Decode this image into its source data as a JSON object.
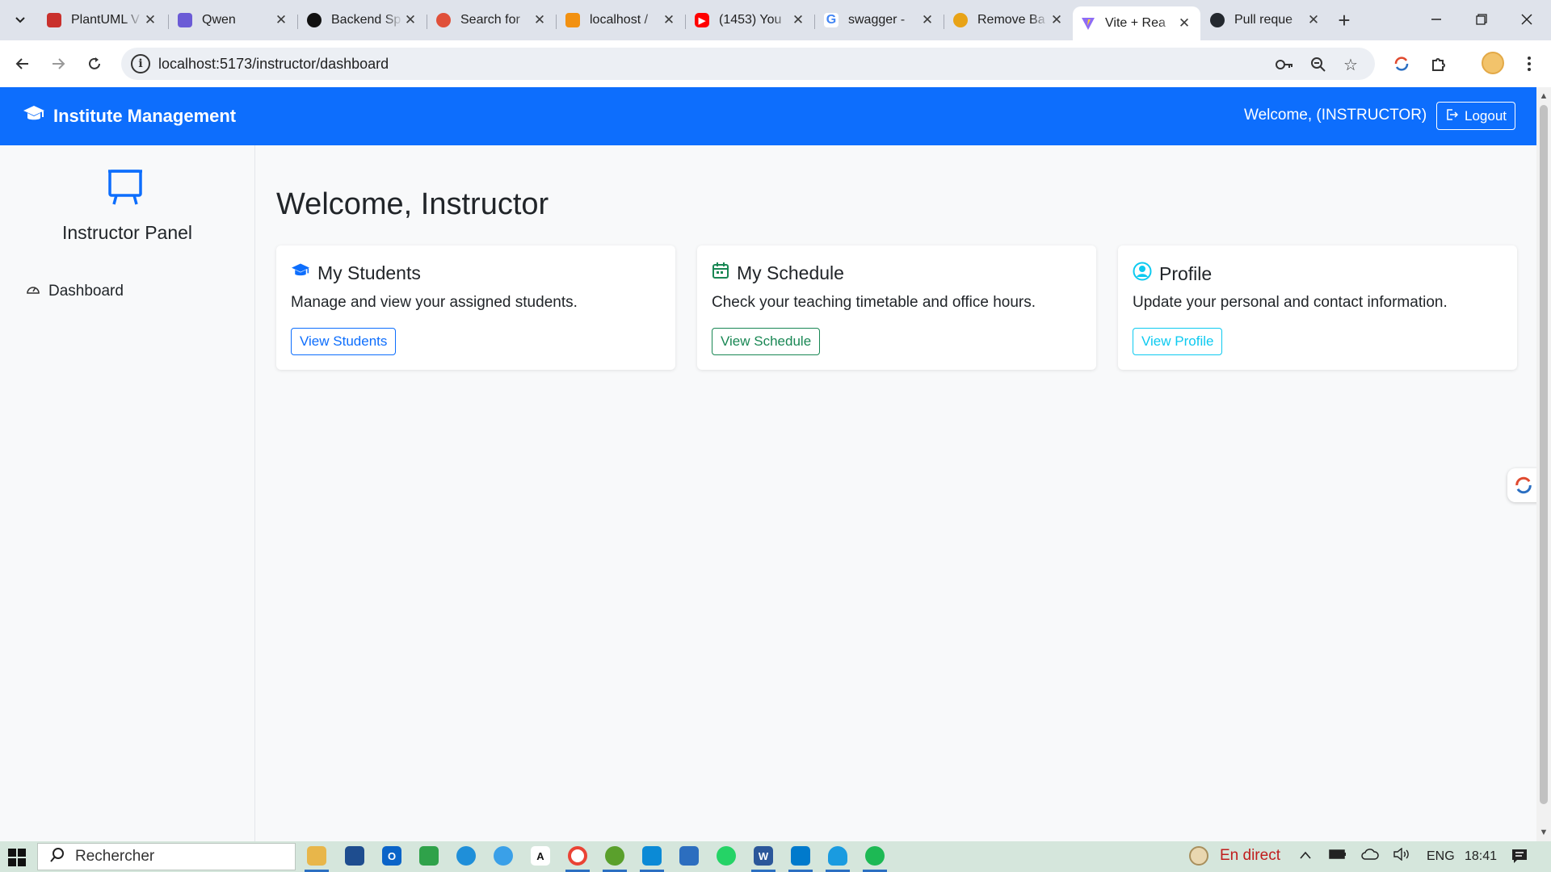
{
  "browser": {
    "tabs": [
      {
        "title": "PlantUML V",
        "favicon": "plantuml-icon",
        "color": "#c9302c"
      },
      {
        "title": "Qwen",
        "favicon": "qwen-icon",
        "color": "#6b5bd6"
      },
      {
        "title": "Backend Sp",
        "favicon": "openai-icon",
        "color": "#111111"
      },
      {
        "title": "Search for",
        "favicon": "search-app-icon",
        "color": "#e0503a"
      },
      {
        "title": "localhost /",
        "favicon": "phpmyadmin-icon",
        "color": "#f29111"
      },
      {
        "title": "(1453) You",
        "favicon": "youtube-icon",
        "color": "#ff0000"
      },
      {
        "title": "swagger -",
        "favicon": "google-icon",
        "color": "#4285f4"
      },
      {
        "title": "Remove Ba",
        "favicon": "remove-bg-icon",
        "color": "#e8a317"
      },
      {
        "title": "Vite + Rea",
        "favicon": "vite-icon",
        "color": "#8e6cf5",
        "active": true
      },
      {
        "title": "Pull reque",
        "favicon": "github-icon",
        "color": "#24292f"
      }
    ],
    "url": "localhost:5173/instructor/dashboard"
  },
  "navbar": {
    "brand": "Institute Management",
    "welcome": "Welcome, (INSTRUCTOR)",
    "logout_label": "Logout",
    "color": "#0d6efd"
  },
  "sidebar": {
    "title": "Instructor Panel",
    "items": [
      {
        "label": "Dashboard",
        "icon": "speedometer-icon"
      }
    ]
  },
  "main": {
    "title": "Welcome, Instructor",
    "cards": [
      {
        "title": "My Students",
        "text": "Manage and view your assigned students.",
        "button": "View Students",
        "icon": "graduation-cap-icon",
        "color": "#0d6efd"
      },
      {
        "title": "My Schedule",
        "text": "Check your teaching timetable and office hours.",
        "button": "View Schedule",
        "icon": "calendar-icon",
        "color": "#198754"
      },
      {
        "title": "Profile",
        "text": "Update your personal and contact information.",
        "button": "View Profile",
        "icon": "person-circle-icon",
        "color": "#0dcaf0"
      }
    ]
  },
  "taskbar": {
    "search_placeholder": "Rechercher",
    "live_label": "En direct",
    "language": "ENG",
    "time": "18:41"
  }
}
